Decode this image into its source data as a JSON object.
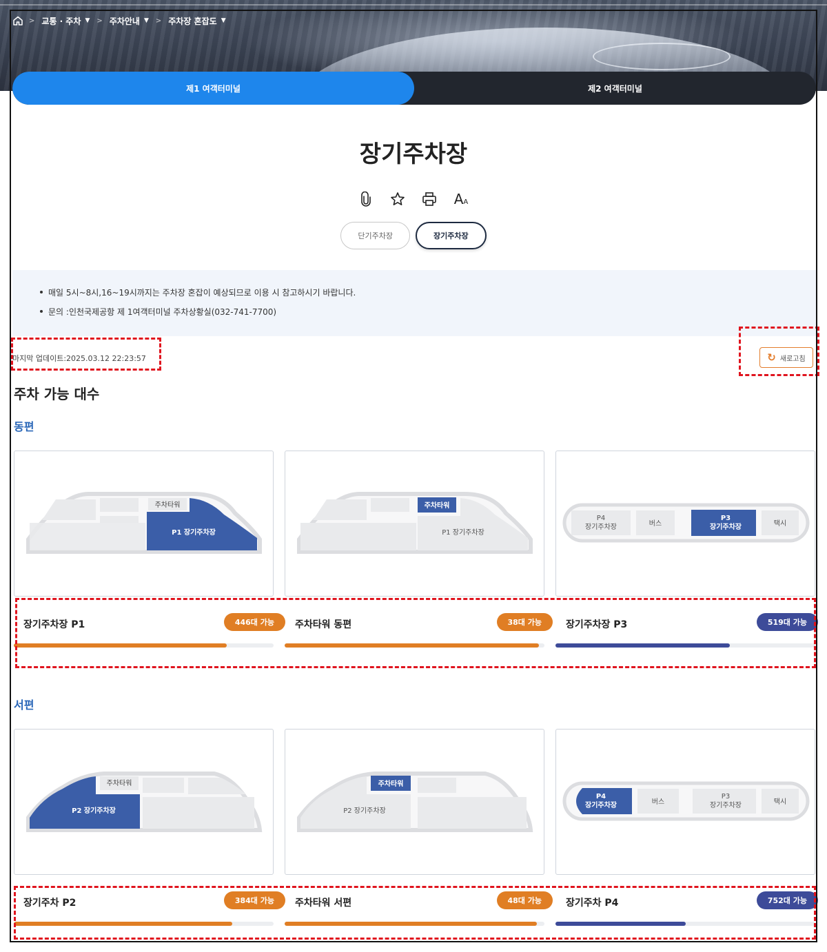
{
  "breadcrumb": {
    "items": [
      {
        "label": "교통 · 주차"
      },
      {
        "label": "주차안내"
      },
      {
        "label": "주차장 혼잡도"
      }
    ]
  },
  "terminal_tabs": [
    {
      "label": "제1 여객터미널",
      "active": true
    },
    {
      "label": "제2 여객터미널",
      "active": false
    }
  ],
  "page": {
    "title": "장기주차장"
  },
  "tools": [
    "clip-icon",
    "star-icon",
    "print-icon",
    "font-size-icon"
  ],
  "tools_text": {
    "font": "A",
    "font_small": "A"
  },
  "lot_tabs": [
    {
      "label": "단기주차장",
      "active": false
    },
    {
      "label": "장기주차장",
      "active": true
    }
  ],
  "notice": [
    "매일 5시~8시,16~19시까지는 주차장 혼잡이 예상되므로 이용 시 참고하시기 바랍니다.",
    "문의 :인천국제공항 제 1여객터미널 주차상황실(032-741-7700)"
  ],
  "update": {
    "text": "마지막 업데이트:2025.03.12 22:23:57",
    "refresh_label": "새로고침"
  },
  "section_title": "주차 가능 대수",
  "colors": {
    "accent_blue": "#1e86ec",
    "orange": "#e07e24",
    "navy": "#3d4b99",
    "lot_blue": "#3b5ea8",
    "alert": "#e0141e"
  },
  "regions": [
    {
      "name": "동편",
      "cards": [
        {
          "map": "left",
          "labels": {
            "tower": "주차타워",
            "lot": "P1 장기주차장"
          },
          "highlight": "lot"
        },
        {
          "map": "left",
          "labels": {
            "tower": "주차타워",
            "lot": "P1 장기주차장"
          },
          "highlight": "tower"
        },
        {
          "map": "strip",
          "labels": {
            "p4_code": "P4",
            "p4_name": "장기주차장",
            "bus": "버스",
            "p3_code": "P3",
            "p3_name": "장기주차장",
            "taxi": "택시"
          },
          "highlight": "p3"
        }
      ],
      "stats": [
        {
          "name": "장기주차장 P1",
          "badge": "446대 가능",
          "ratio": 0.82,
          "color": "orange"
        },
        {
          "name": "주차타워 동편",
          "badge": "38대 가능",
          "ratio": 0.98,
          "color": "orange"
        },
        {
          "name": "장기주차장 P3",
          "badge": "519대 가능",
          "ratio": 0.67,
          "color": "navy"
        }
      ]
    },
    {
      "name": "서편",
      "cards": [
        {
          "map": "right",
          "labels": {
            "tower": "주차타워",
            "lot": "P2 장기주차장"
          },
          "highlight": "lot"
        },
        {
          "map": "right",
          "labels": {
            "tower": "주차타워",
            "lot": "P2 장기주차장"
          },
          "highlight": "tower"
        },
        {
          "map": "strip",
          "labels": {
            "p4_code": "P4",
            "p4_name": "장기주차장",
            "bus": "버스",
            "p3_code": "P3",
            "p3_name": "장기주차장",
            "taxi": "택시"
          },
          "highlight": "p4"
        }
      ],
      "stats": [
        {
          "name": "장기주차 P2",
          "badge": "384대 가능",
          "ratio": 0.84,
          "color": "orange"
        },
        {
          "name": "주차타워 서편",
          "badge": "48대 가능",
          "ratio": 0.97,
          "color": "orange"
        },
        {
          "name": "장기주차 P4",
          "badge": "752대 가능",
          "ratio": 0.5,
          "color": "navy"
        }
      ]
    }
  ]
}
